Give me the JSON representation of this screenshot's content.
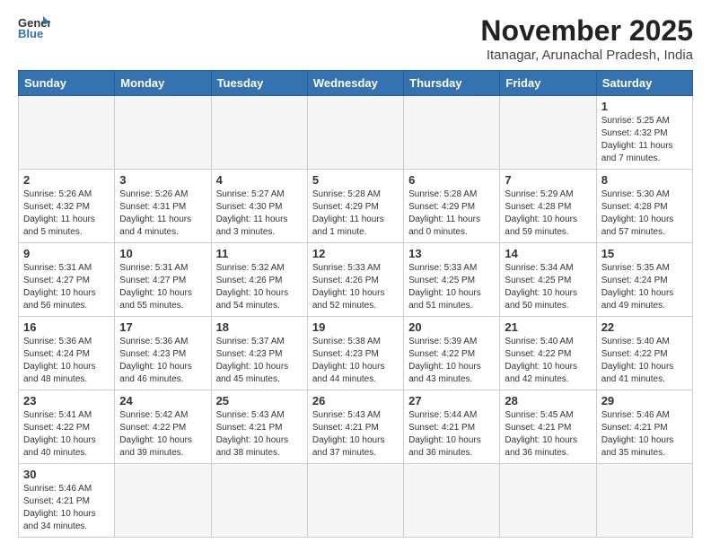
{
  "header": {
    "logo_general": "General",
    "logo_blue": "Blue",
    "month_year": "November 2025",
    "location": "Itanagar, Arunachal Pradesh, India"
  },
  "weekdays": [
    "Sunday",
    "Monday",
    "Tuesday",
    "Wednesday",
    "Thursday",
    "Friday",
    "Saturday"
  ],
  "weeks": [
    [
      {
        "day": "",
        "info": ""
      },
      {
        "day": "",
        "info": ""
      },
      {
        "day": "",
        "info": ""
      },
      {
        "day": "",
        "info": ""
      },
      {
        "day": "",
        "info": ""
      },
      {
        "day": "",
        "info": ""
      },
      {
        "day": "1",
        "info": "Sunrise: 5:25 AM\nSunset: 4:32 PM\nDaylight: 11 hours\nand 7 minutes."
      }
    ],
    [
      {
        "day": "2",
        "info": "Sunrise: 5:26 AM\nSunset: 4:32 PM\nDaylight: 11 hours\nand 5 minutes."
      },
      {
        "day": "3",
        "info": "Sunrise: 5:26 AM\nSunset: 4:31 PM\nDaylight: 11 hours\nand 4 minutes."
      },
      {
        "day": "4",
        "info": "Sunrise: 5:27 AM\nSunset: 4:30 PM\nDaylight: 11 hours\nand 3 minutes."
      },
      {
        "day": "5",
        "info": "Sunrise: 5:28 AM\nSunset: 4:29 PM\nDaylight: 11 hours\nand 1 minute."
      },
      {
        "day": "6",
        "info": "Sunrise: 5:28 AM\nSunset: 4:29 PM\nDaylight: 11 hours\nand 0 minutes."
      },
      {
        "day": "7",
        "info": "Sunrise: 5:29 AM\nSunset: 4:28 PM\nDaylight: 10 hours\nand 59 minutes."
      },
      {
        "day": "8",
        "info": "Sunrise: 5:30 AM\nSunset: 4:28 PM\nDaylight: 10 hours\nand 57 minutes."
      }
    ],
    [
      {
        "day": "9",
        "info": "Sunrise: 5:31 AM\nSunset: 4:27 PM\nDaylight: 10 hours\nand 56 minutes."
      },
      {
        "day": "10",
        "info": "Sunrise: 5:31 AM\nSunset: 4:27 PM\nDaylight: 10 hours\nand 55 minutes."
      },
      {
        "day": "11",
        "info": "Sunrise: 5:32 AM\nSunset: 4:26 PM\nDaylight: 10 hours\nand 54 minutes."
      },
      {
        "day": "12",
        "info": "Sunrise: 5:33 AM\nSunset: 4:26 PM\nDaylight: 10 hours\nand 52 minutes."
      },
      {
        "day": "13",
        "info": "Sunrise: 5:33 AM\nSunset: 4:25 PM\nDaylight: 10 hours\nand 51 minutes."
      },
      {
        "day": "14",
        "info": "Sunrise: 5:34 AM\nSunset: 4:25 PM\nDaylight: 10 hours\nand 50 minutes."
      },
      {
        "day": "15",
        "info": "Sunrise: 5:35 AM\nSunset: 4:24 PM\nDaylight: 10 hours\nand 49 minutes."
      }
    ],
    [
      {
        "day": "16",
        "info": "Sunrise: 5:36 AM\nSunset: 4:24 PM\nDaylight: 10 hours\nand 48 minutes."
      },
      {
        "day": "17",
        "info": "Sunrise: 5:36 AM\nSunset: 4:23 PM\nDaylight: 10 hours\nand 46 minutes."
      },
      {
        "day": "18",
        "info": "Sunrise: 5:37 AM\nSunset: 4:23 PM\nDaylight: 10 hours\nand 45 minutes."
      },
      {
        "day": "19",
        "info": "Sunrise: 5:38 AM\nSunset: 4:23 PM\nDaylight: 10 hours\nand 44 minutes."
      },
      {
        "day": "20",
        "info": "Sunrise: 5:39 AM\nSunset: 4:22 PM\nDaylight: 10 hours\nand 43 minutes."
      },
      {
        "day": "21",
        "info": "Sunrise: 5:40 AM\nSunset: 4:22 PM\nDaylight: 10 hours\nand 42 minutes."
      },
      {
        "day": "22",
        "info": "Sunrise: 5:40 AM\nSunset: 4:22 PM\nDaylight: 10 hours\nand 41 minutes."
      }
    ],
    [
      {
        "day": "23",
        "info": "Sunrise: 5:41 AM\nSunset: 4:22 PM\nDaylight: 10 hours\nand 40 minutes."
      },
      {
        "day": "24",
        "info": "Sunrise: 5:42 AM\nSunset: 4:22 PM\nDaylight: 10 hours\nand 39 minutes."
      },
      {
        "day": "25",
        "info": "Sunrise: 5:43 AM\nSunset: 4:21 PM\nDaylight: 10 hours\nand 38 minutes."
      },
      {
        "day": "26",
        "info": "Sunrise: 5:43 AM\nSunset: 4:21 PM\nDaylight: 10 hours\nand 37 minutes."
      },
      {
        "day": "27",
        "info": "Sunrise: 5:44 AM\nSunset: 4:21 PM\nDaylight: 10 hours\nand 36 minutes."
      },
      {
        "day": "28",
        "info": "Sunrise: 5:45 AM\nSunset: 4:21 PM\nDaylight: 10 hours\nand 36 minutes."
      },
      {
        "day": "29",
        "info": "Sunrise: 5:46 AM\nSunset: 4:21 PM\nDaylight: 10 hours\nand 35 minutes."
      }
    ],
    [
      {
        "day": "30",
        "info": "Sunrise: 5:46 AM\nSunset: 4:21 PM\nDaylight: 10 hours\nand 34 minutes."
      },
      {
        "day": "",
        "info": ""
      },
      {
        "day": "",
        "info": ""
      },
      {
        "day": "",
        "info": ""
      },
      {
        "day": "",
        "info": ""
      },
      {
        "day": "",
        "info": ""
      },
      {
        "day": "",
        "info": ""
      }
    ]
  ]
}
